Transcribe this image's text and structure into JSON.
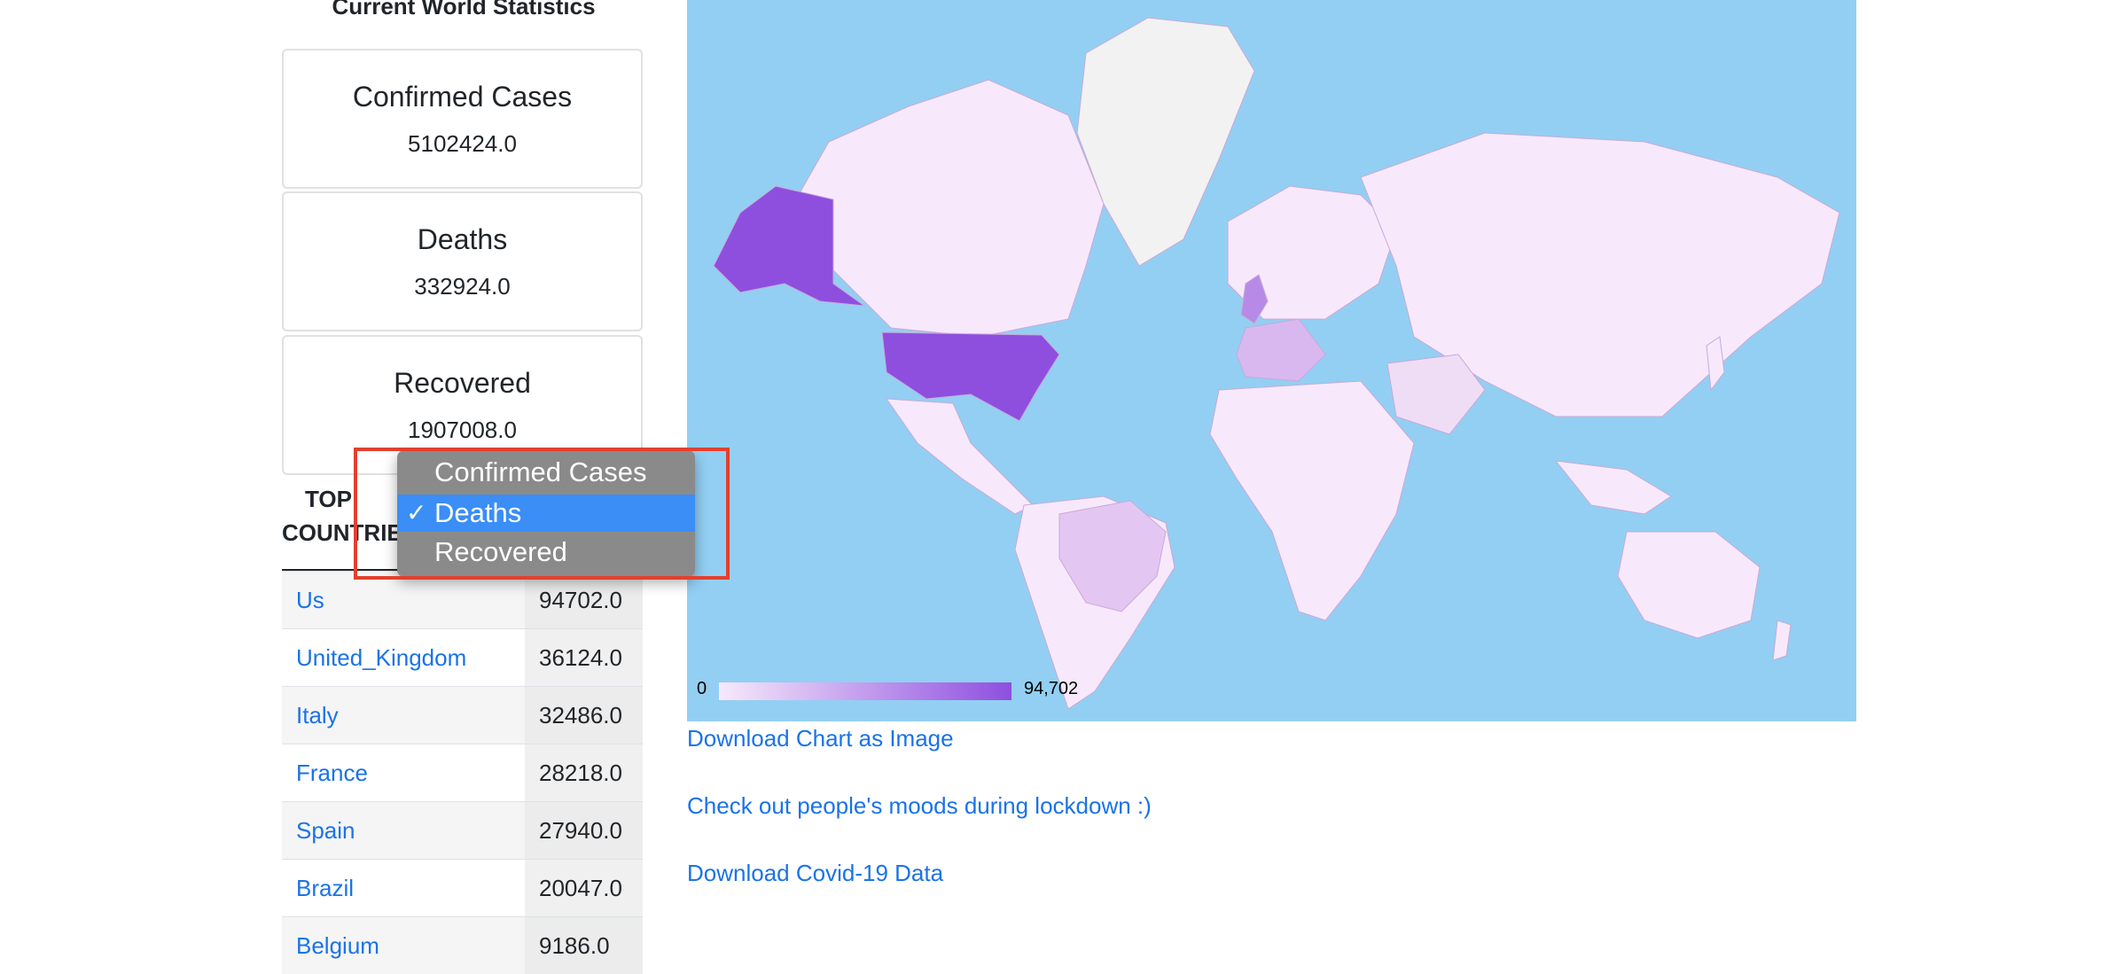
{
  "section_title": "Current World Statistics",
  "stats": [
    {
      "title": "Confirmed Cases",
      "value": "5102424.0"
    },
    {
      "title": "Deaths",
      "value": "332924.0"
    },
    {
      "title": "Recovered",
      "value": "1907008.0"
    }
  ],
  "top_header": {
    "line1": "TOP",
    "line2": "COUNTRIES"
  },
  "countries": [
    {
      "name": "Us",
      "value": "94702.0"
    },
    {
      "name": "United_Kingdom",
      "value": "36124.0"
    },
    {
      "name": "Italy",
      "value": "32486.0"
    },
    {
      "name": "France",
      "value": "28218.0"
    },
    {
      "name": "Spain",
      "value": "27940.0"
    },
    {
      "name": "Brazil",
      "value": "20047.0"
    },
    {
      "name": "Belgium",
      "value": "9186.0"
    }
  ],
  "dropdown": {
    "options": [
      "Confirmed Cases",
      "Deaths",
      "Recovered"
    ],
    "selected": "Deaths",
    "check_glyph": "✓"
  },
  "map": {
    "legend_min": "0",
    "legend_max": "94,702",
    "colors": {
      "ocean": "#93cff3",
      "low": "#f7e9fb",
      "high": "#8e4fdf",
      "greenland": "#f2f2f2"
    }
  },
  "links": {
    "download_chart": "Download Chart as Image",
    "moods": "Check out people's moods during lockdown :)",
    "download_data": "Download Covid-19 Data"
  }
}
